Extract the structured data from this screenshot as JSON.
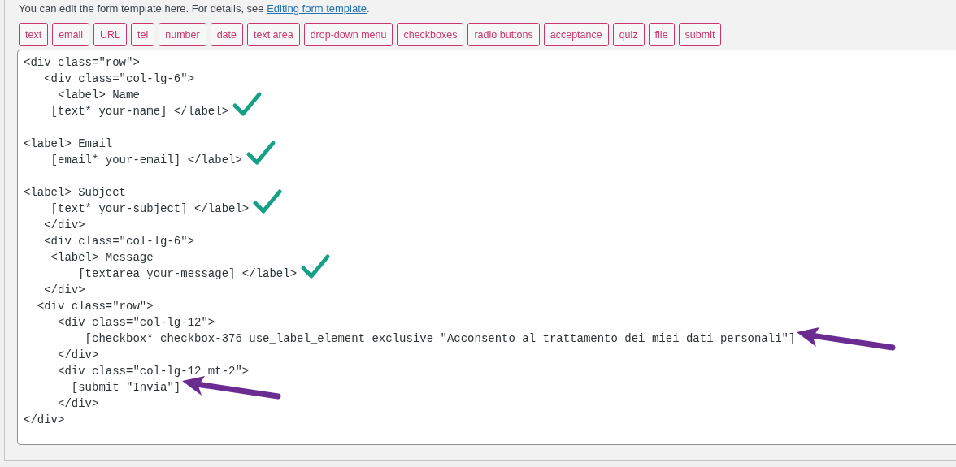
{
  "intro": {
    "text": "You can edit the form template here. For details, see ",
    "link": "Editing form template",
    "after": "."
  },
  "tag_buttons": [
    "text",
    "email",
    "URL",
    "tel",
    "number",
    "date",
    "text area",
    "drop-down menu",
    "checkboxes",
    "radio buttons",
    "acceptance",
    "quiz",
    "file",
    "submit"
  ],
  "editor": {
    "lines": [
      {
        "kind": "code",
        "text": "<div class=\"row\">"
      },
      {
        "kind": "code",
        "text": "   <div class=\"col-lg-6\">"
      },
      {
        "kind": "code",
        "text": "     <label> Name"
      },
      {
        "kind": "code",
        "text": "    [text* your-name] </label>",
        "checkmark": true
      },
      {
        "kind": "blank"
      },
      {
        "kind": "code",
        "text": "<label> Email"
      },
      {
        "kind": "code",
        "text": "    [email* your-email] </label>",
        "checkmark": true
      },
      {
        "kind": "blank"
      },
      {
        "kind": "code",
        "text": "<label> Subject"
      },
      {
        "kind": "code",
        "text": "    [text* your-subject] </label>",
        "checkmark": true
      },
      {
        "kind": "code",
        "text": "   </div>"
      },
      {
        "kind": "code",
        "text": "   <div class=\"col-lg-6\">"
      },
      {
        "kind": "code",
        "text": "    <label> Message"
      },
      {
        "kind": "code",
        "text": "        [textarea your-message] </label>",
        "checkmark": true
      },
      {
        "kind": "code",
        "text": "   </div>"
      },
      {
        "kind": "code",
        "text": "  <div class=\"row\">"
      },
      {
        "kind": "code",
        "text": "     <div class=\"col-lg-12\">"
      },
      {
        "kind": "code",
        "text": "         [checkbox* checkbox-376 use_label_element exclusive \"Acconsento al trattamento dei miei dati personali\"]",
        "arrow": true
      },
      {
        "kind": "code",
        "text": "     </div>"
      },
      {
        "kind": "code",
        "text": "     <div class=\"col-lg-12 mt-2\">"
      },
      {
        "kind": "code",
        "text": "       [submit \"Invia\"]",
        "arrow": true
      },
      {
        "kind": "code",
        "text": "     </div>"
      },
      {
        "kind": "code",
        "text": "</div>"
      }
    ]
  }
}
